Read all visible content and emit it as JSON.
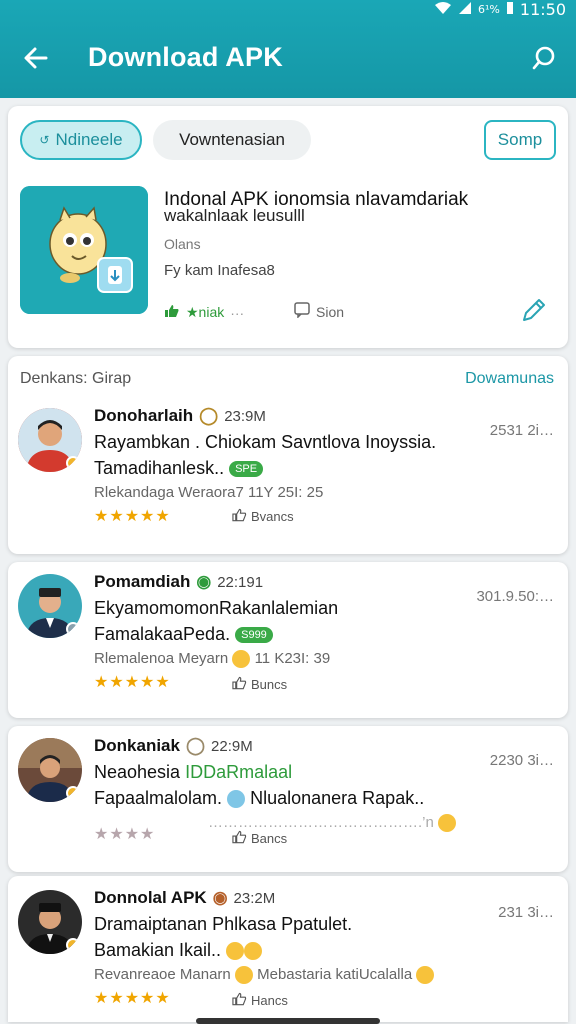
{
  "status": {
    "percent": "6¹%",
    "time": "11:50"
  },
  "header": {
    "title": "Download APK"
  },
  "top_card": {
    "chip_active": "Ndineele",
    "chip_plain": "Vowntenasian",
    "button": "Somp",
    "app_title_line1": "Indonal APK ionomsia nlavamdariak",
    "app_title_line2": "wakalnlaak leusulll",
    "app_size": "Olans",
    "app_version": "Fy kam Inafesa8",
    "rating_label": "★niak",
    "rating_dots": "···",
    "sign_label": "Sion"
  },
  "reviews_section": {
    "title": "Denkans: Girap",
    "link": "Dowamunas"
  },
  "reviews": [
    {
      "name": "Donoharlaih",
      "time": "23:9M",
      "date": "2531 2i…",
      "line1": "Rayambkan . Chiokam Savntlova Inoyssia.",
      "line2": "Tamadihanlesk..",
      "pill": "SPE",
      "meta": "Rlekandaga Weraora7 11Y 25I: 25",
      "stars": "★★★★★",
      "like": "Bvancs"
    },
    {
      "name": "Pomamdiah",
      "time": "22:191",
      "date": "301.9.50:…",
      "line1": "EkyamomomonRakanlalemian",
      "line2": "FamalakaaPeda.",
      "pill": "S999",
      "meta": "Rlemalenoa Meyarn",
      "meta2": "11 K23I: 39",
      "stars": "★★★★★",
      "like": "Buncs"
    },
    {
      "name": "Donkaniak",
      "time": "22:9M",
      "date": "2230 3i…",
      "line1a": "Neaohesia ",
      "line1b": "IDDaRmalaal",
      "line2a": "Fapaalmalolam.",
      "line2b": "Nlualonanera Rapak..",
      "meta": "…………………………………….’n",
      "stars": "★★★★",
      "like": "Bancs"
    },
    {
      "name": "Donnolal APK",
      "time": "23:2M",
      "date": "231 3i…",
      "line1": "Dramaiptanan Phlkasa Ppatulet.",
      "line2": "Bamakian Ikail..",
      "meta1": "Revanreaoe Manarn",
      "meta2": "Mebastaria katiUcalalla",
      "stars": "★★★★★",
      "like": "Hancs"
    }
  ],
  "colors": {
    "primary": "#1aa7b6",
    "accent": "#2bb5c2",
    "star": "#f0a500",
    "green": "#3aaa47"
  }
}
